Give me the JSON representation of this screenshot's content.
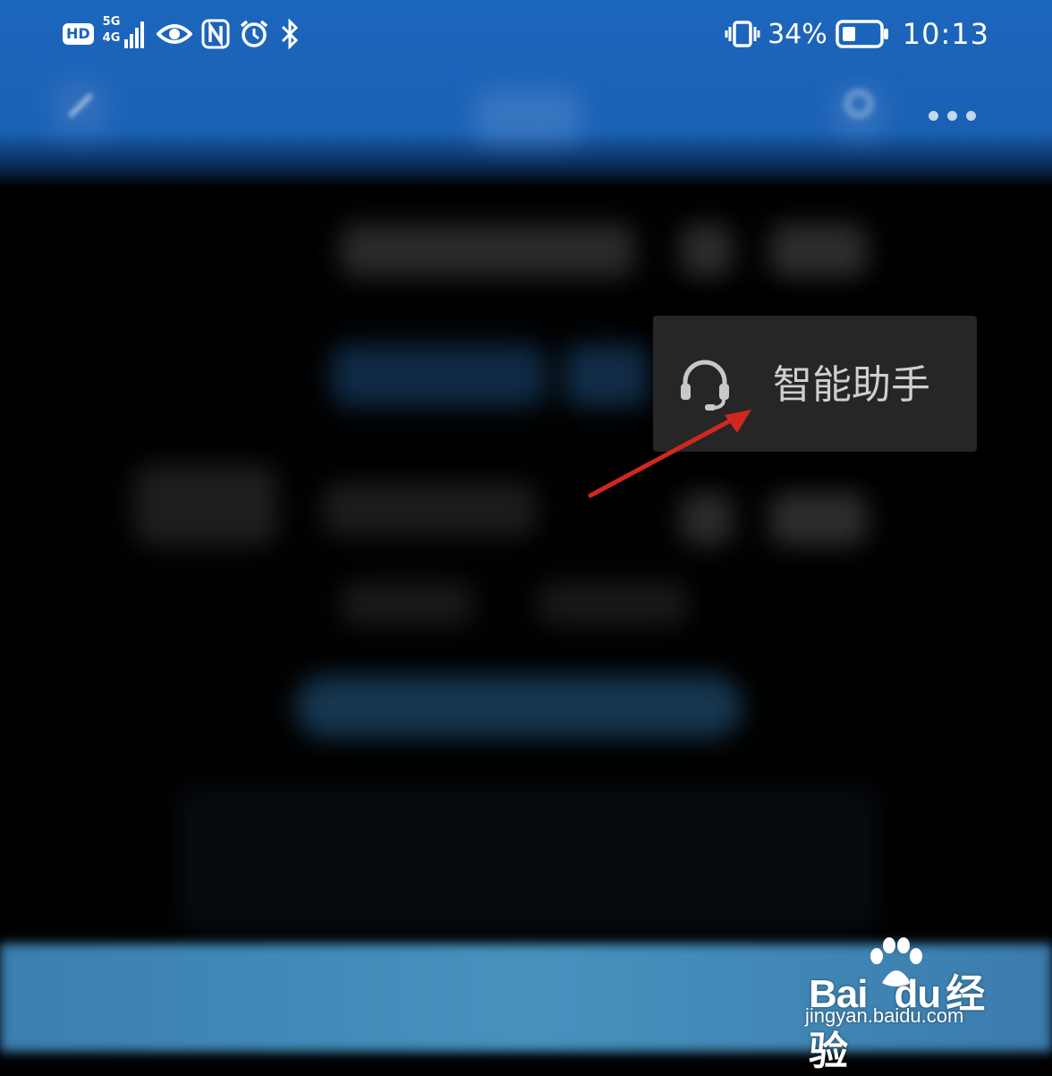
{
  "status_bar": {
    "hd_label": "HD",
    "network_top": "5G",
    "network_bottom": "4G",
    "battery_percent": "34%",
    "time": "10:13",
    "icons": [
      "hd-icon",
      "signal-icon",
      "eye-comfort-icon",
      "nfc-icon",
      "alarm-icon",
      "bluetooth-icon",
      "vibrate-icon",
      "battery-icon"
    ]
  },
  "toolbar": {
    "icons": [
      "edit-icon",
      "search-icon",
      "more-icon"
    ]
  },
  "popup_menu": {
    "items": [
      {
        "label": "智能助手",
        "icon": "headset-icon"
      }
    ]
  },
  "annotation": {
    "arrow_color": "#d0281f"
  },
  "watermark": {
    "brand_left": "Bai",
    "brand_mid": "du",
    "brand_right": "经验",
    "url": "jingyan.baidu.com"
  },
  "colors": {
    "header_blue": "#1c66bd",
    "popup_bg": "#262626",
    "popup_text": "#cfcfcf"
  }
}
